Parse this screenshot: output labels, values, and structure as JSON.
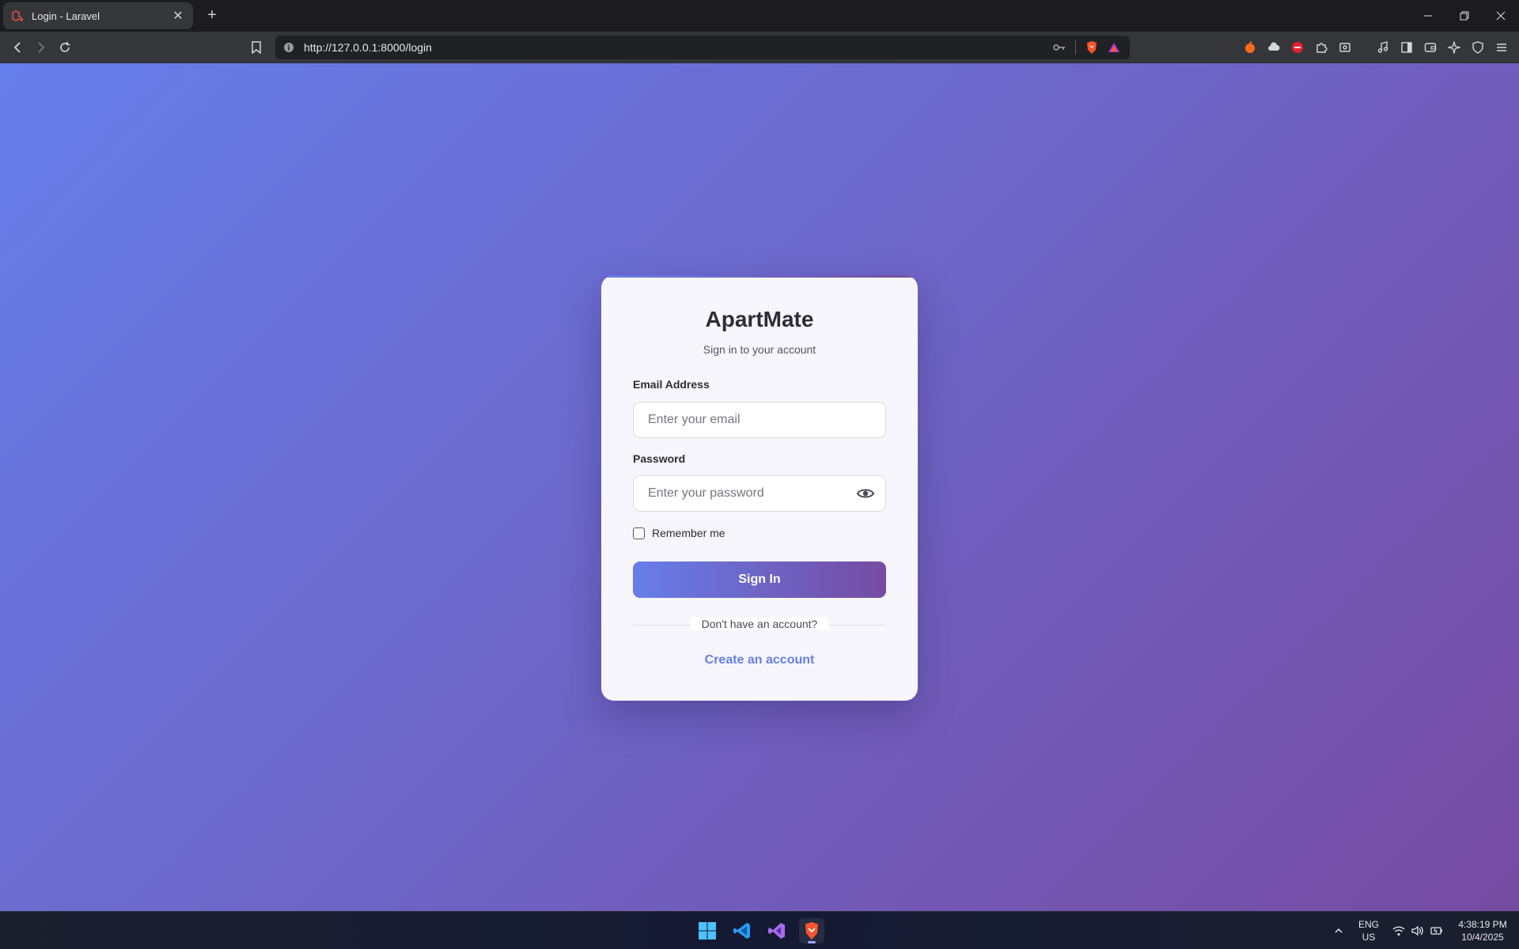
{
  "browser": {
    "tab_title": "Login - Laravel",
    "url": "http://127.0.0.1:8000/login"
  },
  "login": {
    "app_name": "ApartMate",
    "subtitle": "Sign in to your account",
    "email_label": "Email Address",
    "email_placeholder": "Enter your email",
    "password_label": "Password",
    "password_placeholder": "Enter your password",
    "remember_label": "Remember me",
    "signin_label": "Sign In",
    "no_account_text": "Don't have an account?",
    "create_account_link": "Create an account"
  },
  "taskbar": {
    "lang_primary": "ENG",
    "lang_secondary": "US",
    "time": "4:38:19 PM",
    "date": "10/4/2025"
  },
  "colors": {
    "gradient_start": "#667eea",
    "gradient_end": "#764ba2",
    "link": "#667eea"
  }
}
